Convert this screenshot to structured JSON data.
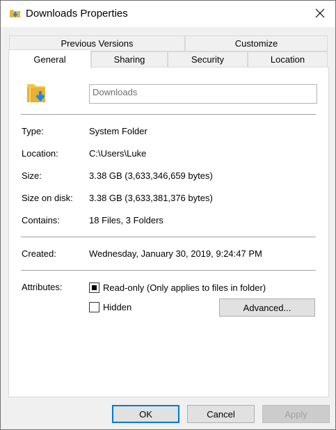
{
  "window": {
    "title": "Downloads Properties",
    "close_glyph": "✕"
  },
  "tabs": {
    "row_back": [
      "Previous Versions",
      "Customize"
    ],
    "row_front": [
      "General",
      "Sharing",
      "Security",
      "Location"
    ],
    "active": "General"
  },
  "general": {
    "folder_name": "Downloads",
    "fields": {
      "type_label": "Type:",
      "type_value": "System Folder",
      "location_label": "Location:",
      "location_value": "C:\\Users\\Luke",
      "size_label": "Size:",
      "size_value": "3.38 GB (3,633,346,659 bytes)",
      "size_on_disk_label": "Size on disk:",
      "size_on_disk_value": "3.38 GB (3,633,381,376 bytes)",
      "contains_label": "Contains:",
      "contains_value": "18 Files, 3 Folders",
      "created_label": "Created:",
      "created_value": "Wednesday, January 30, 2019, 9:24:47 PM"
    },
    "attributes": {
      "label": "Attributes:",
      "readonly_label": "Read-only (Only applies to files in folder)",
      "readonly_state": "indeterminate",
      "hidden_label": "Hidden",
      "hidden_state": "unchecked",
      "advanced_label": "Advanced..."
    }
  },
  "buttons": {
    "ok": "OK",
    "cancel": "Cancel",
    "apply": "Apply"
  },
  "icons": [
    "folder-download-icon",
    "close-icon"
  ],
  "colors": {
    "accent": "#0078d7",
    "folder_yellow": "#f5c542",
    "arrow_blue": "#1e88e5"
  }
}
